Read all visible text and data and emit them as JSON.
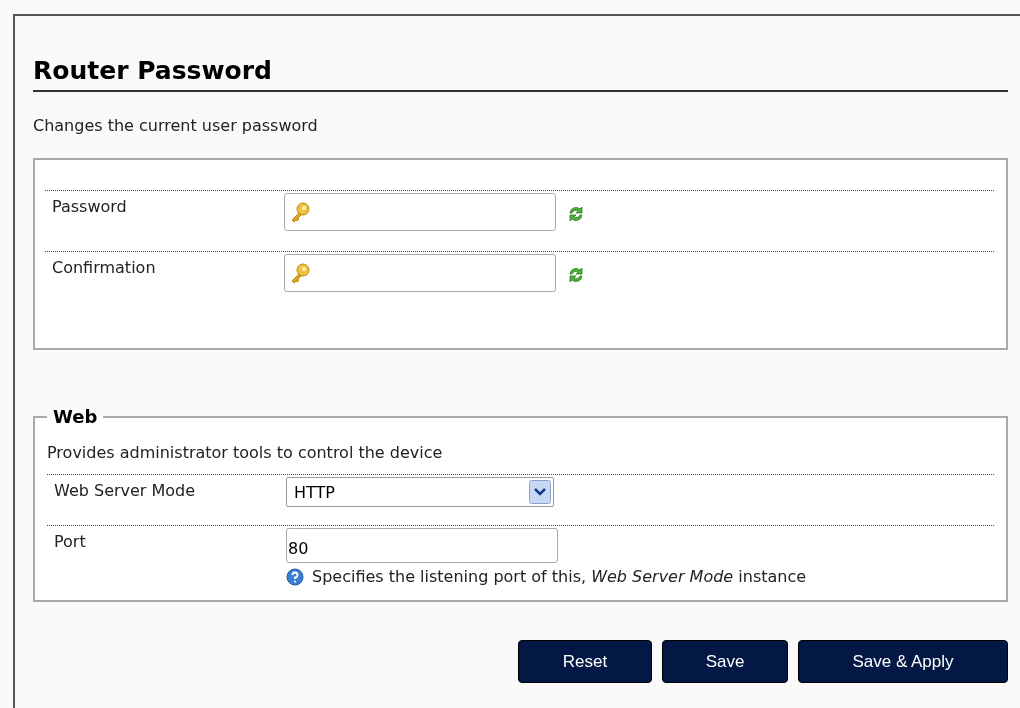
{
  "title": "Router Password",
  "description": "Changes the current user password",
  "password_section": {
    "rows": [
      {
        "label": "Password",
        "kind": "password",
        "value": ""
      },
      {
        "label": "Confirmation",
        "kind": "password",
        "value": ""
      }
    ]
  },
  "web_section": {
    "legend": "Web",
    "description": "Provides administrator tools to control the device",
    "rows": [
      {
        "label": "Web Server Mode",
        "kind": "select",
        "value": "HTTP"
      },
      {
        "label": "Port",
        "kind": "text",
        "value": "80",
        "help": "Specifies the listening port of this, *Web Server Mode* instance"
      }
    ]
  },
  "buttons": [
    "Reset",
    "Save",
    "Save & Apply"
  ]
}
